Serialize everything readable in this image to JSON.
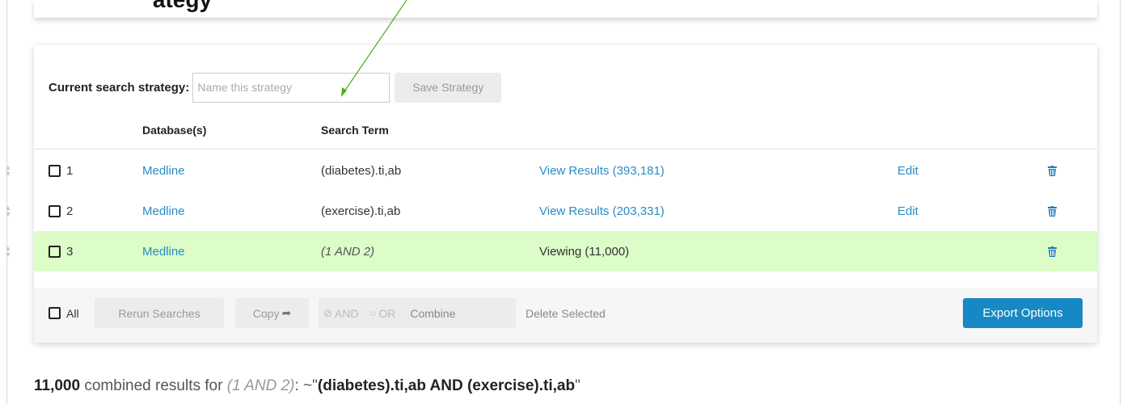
{
  "top_heading": "...ategy",
  "strategy": {
    "label": "Current search strategy:",
    "placeholder": "Name this strategy",
    "save_button": "Save Strategy"
  },
  "table": {
    "headers": [
      "Database(s)",
      "Search Term"
    ],
    "rows": [
      {
        "num": "1",
        "database": "Medline",
        "term": "(diabetes).ti,ab",
        "results": "View Results (393,181)",
        "edit": "Edit"
      },
      {
        "num": "2",
        "database": "Medline",
        "term": "(exercise).ti,ab",
        "results": "View Results (203,331)",
        "edit": "Edit"
      },
      {
        "num": "3",
        "database": "Medline",
        "term": "(1 AND 2)",
        "results": "Viewing (11,000)",
        "edit": ""
      }
    ]
  },
  "footer": {
    "all_label": "All",
    "rerun": "Rerun Searches",
    "copy": "Copy",
    "and_label": "AND",
    "or_label": "OR",
    "combine": "Combine",
    "delete_selected": "Delete Selected",
    "export": "Export Options"
  },
  "results": {
    "count": "11,000",
    "text": " combined results for ",
    "query_short": "(1 AND 2)",
    "sep": ": ~\"",
    "query_full": "(diabetes).ti,ab AND (exercise).ti,ab",
    "end": "\""
  },
  "colors": {
    "link": "#2a8cc4",
    "highlight_row": "#dcfcc8",
    "export_button": "#1689c4",
    "annotation_arrow": "#4caf1a"
  }
}
